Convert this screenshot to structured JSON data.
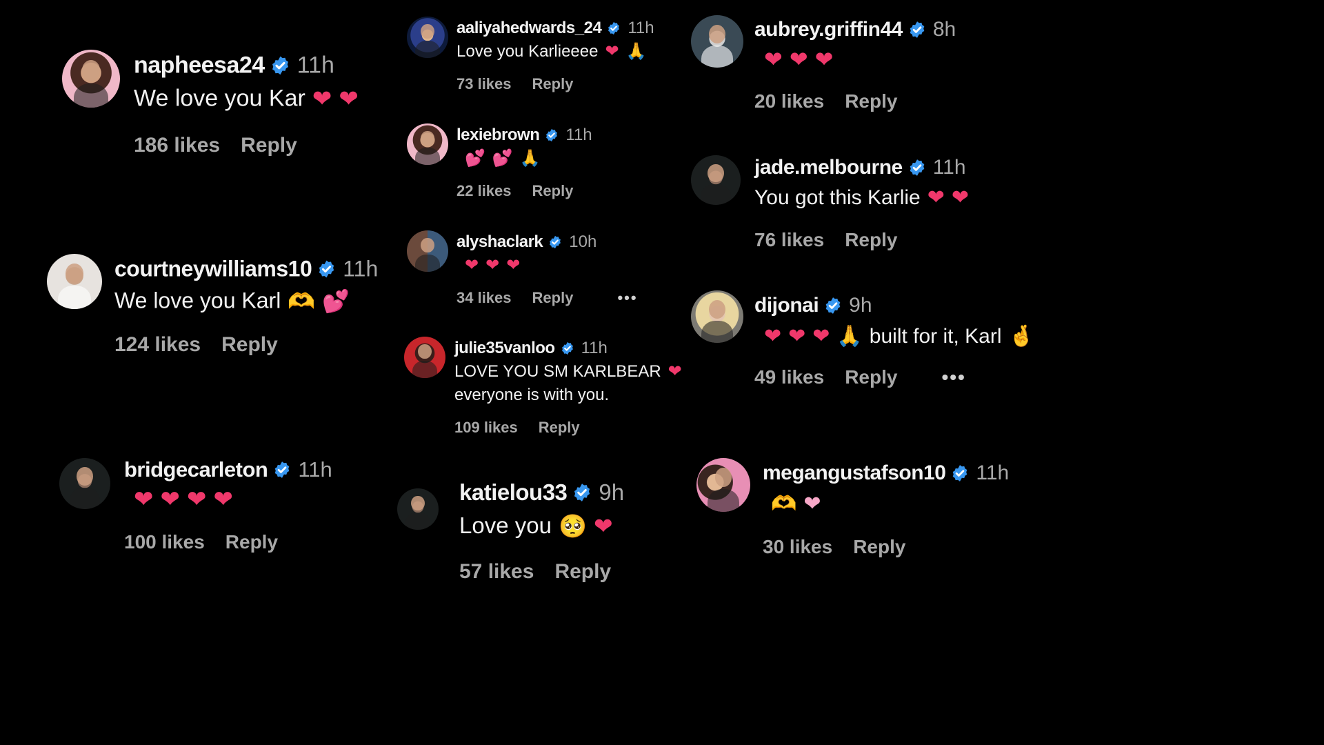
{
  "comments": [
    {
      "username": "napheesa24",
      "time": "11h",
      "text": "We love you Kar",
      "emojis": [
        {
          "name": "red-heart",
          "char": "❤"
        },
        {
          "name": "red-heart",
          "char": "❤"
        }
      ],
      "likes": "186 likes",
      "reply": "Reply"
    },
    {
      "username": "courtneywilliams10",
      "time": "11h",
      "text": "We love you Karl",
      "emojis": [
        {
          "name": "heart-hands",
          "char": "🫶"
        },
        {
          "name": "two-hearts",
          "char": "💕"
        }
      ],
      "likes": "124 likes",
      "reply": "Reply"
    },
    {
      "username": "bridgecarleton",
      "time": "11h",
      "text": "",
      "emojis": [
        {
          "name": "red-heart",
          "char": "❤"
        },
        {
          "name": "red-heart",
          "char": "❤"
        },
        {
          "name": "red-heart",
          "char": "❤"
        },
        {
          "name": "red-heart",
          "char": "❤"
        }
      ],
      "likes": "100 likes",
      "reply": "Reply"
    },
    {
      "username": "aaliyahedwards_24",
      "time": "11h",
      "text": "Love you Karlieeee",
      "emojis": [
        {
          "name": "red-heart",
          "char": "❤"
        },
        {
          "name": "praying-hands",
          "char": "🙏"
        }
      ],
      "likes": "73 likes",
      "reply": "Reply"
    },
    {
      "username": "lexiebrown",
      "time": "11h",
      "text": "",
      "emojis": [
        {
          "name": "two-hearts",
          "char": "💕"
        },
        {
          "name": "two-hearts",
          "char": "💕"
        },
        {
          "name": "praying-hands",
          "char": "🙏"
        }
      ],
      "likes": "22 likes",
      "reply": "Reply"
    },
    {
      "username": "alyshaclark",
      "time": "10h",
      "text": "",
      "emojis": [
        {
          "name": "red-heart",
          "char": "❤"
        },
        {
          "name": "red-heart",
          "char": "❤"
        },
        {
          "name": "red-heart",
          "char": "❤"
        }
      ],
      "likes": "34 likes",
      "reply": "Reply",
      "more": "•••"
    },
    {
      "username": "julie35vanloo",
      "time": "11h",
      "text": "LOVE YOU SM KARLBEAR",
      "text2": "everyone is with you.",
      "emojis": [
        {
          "name": "red-heart",
          "char": "❤"
        }
      ],
      "likes": "109 likes",
      "reply": "Reply"
    },
    {
      "username": "katielou33",
      "time": "9h",
      "text": "Love you",
      "emojis": [
        {
          "name": "pleading-face",
          "char": "🥺"
        },
        {
          "name": "red-heart",
          "char": "❤"
        }
      ],
      "likes": "57 likes",
      "reply": "Reply"
    },
    {
      "username": "aubrey.griffin44",
      "time": "8h",
      "text": "",
      "emojis": [
        {
          "name": "red-heart",
          "char": "❤"
        },
        {
          "name": "red-heart",
          "char": "❤"
        },
        {
          "name": "red-heart",
          "char": "❤"
        }
      ],
      "likes": "20 likes",
      "reply": "Reply"
    },
    {
      "username": "jade.melbourne",
      "time": "11h",
      "text": "You got this Karlie",
      "emojis": [
        {
          "name": "red-heart",
          "char": "❤"
        },
        {
          "name": "red-heart",
          "char": "❤"
        }
      ],
      "likes": "76 likes",
      "reply": "Reply"
    },
    {
      "username": "dijonai",
      "time": "9h",
      "text": "built for it, Karl",
      "emojis_before": [
        {
          "name": "pink-heart",
          "char": "❤"
        },
        {
          "name": "pink-heart",
          "char": "❤"
        },
        {
          "name": "pink-heart",
          "char": "❤"
        },
        {
          "name": "praying-hands",
          "char": "🙏"
        }
      ],
      "emojis": [
        {
          "name": "crossed-fingers",
          "char": "🤞"
        }
      ],
      "likes": "49 likes",
      "reply": "Reply",
      "more": "•••"
    },
    {
      "username": "megangustafson10",
      "time": "11h",
      "text": "",
      "emojis": [
        {
          "name": "heart-hands",
          "char": "🫶"
        },
        {
          "name": "pride-heart",
          "char": "❤"
        }
      ],
      "likes": "30 likes",
      "reply": "Reply"
    }
  ],
  "colors": {
    "background": "#000000",
    "verified": "#3897f0",
    "heart": "#f0386b",
    "meta": "#a8a8a8"
  }
}
